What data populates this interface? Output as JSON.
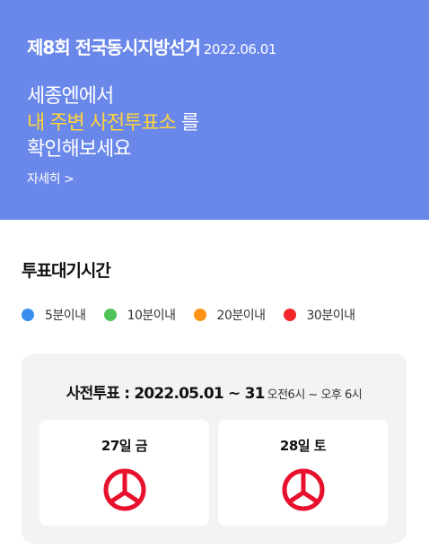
{
  "banner": {
    "title": "제8회 전국동시지방선거",
    "date": "2022.06.01",
    "line1": "세종엔에서",
    "line2_highlight": "내 주변 사전투표소",
    "line2_rest": "를",
    "line3": "확인해보세요",
    "detail_link": "자세히 >"
  },
  "section": {
    "title": "투표대기시간"
  },
  "legend": [
    {
      "label": "5분이내",
      "color": "#3a8ef0"
    },
    {
      "label": "10분이내",
      "color": "#50c35a"
    },
    {
      "label": "20분이내",
      "color": "#ff9315"
    },
    {
      "label": "30분이내",
      "color": "#f0262b"
    }
  ],
  "card": {
    "heading": "사전투표 : 2022.05.01 ~ 31",
    "hours": "오전6시 ~ 오후 6시",
    "days": [
      {
        "label": "27일 금",
        "icon": "vote-stamp-icon"
      },
      {
        "label": "28일 토",
        "icon": "vote-stamp-icon"
      }
    ],
    "stamp_color": "#e8112d"
  }
}
